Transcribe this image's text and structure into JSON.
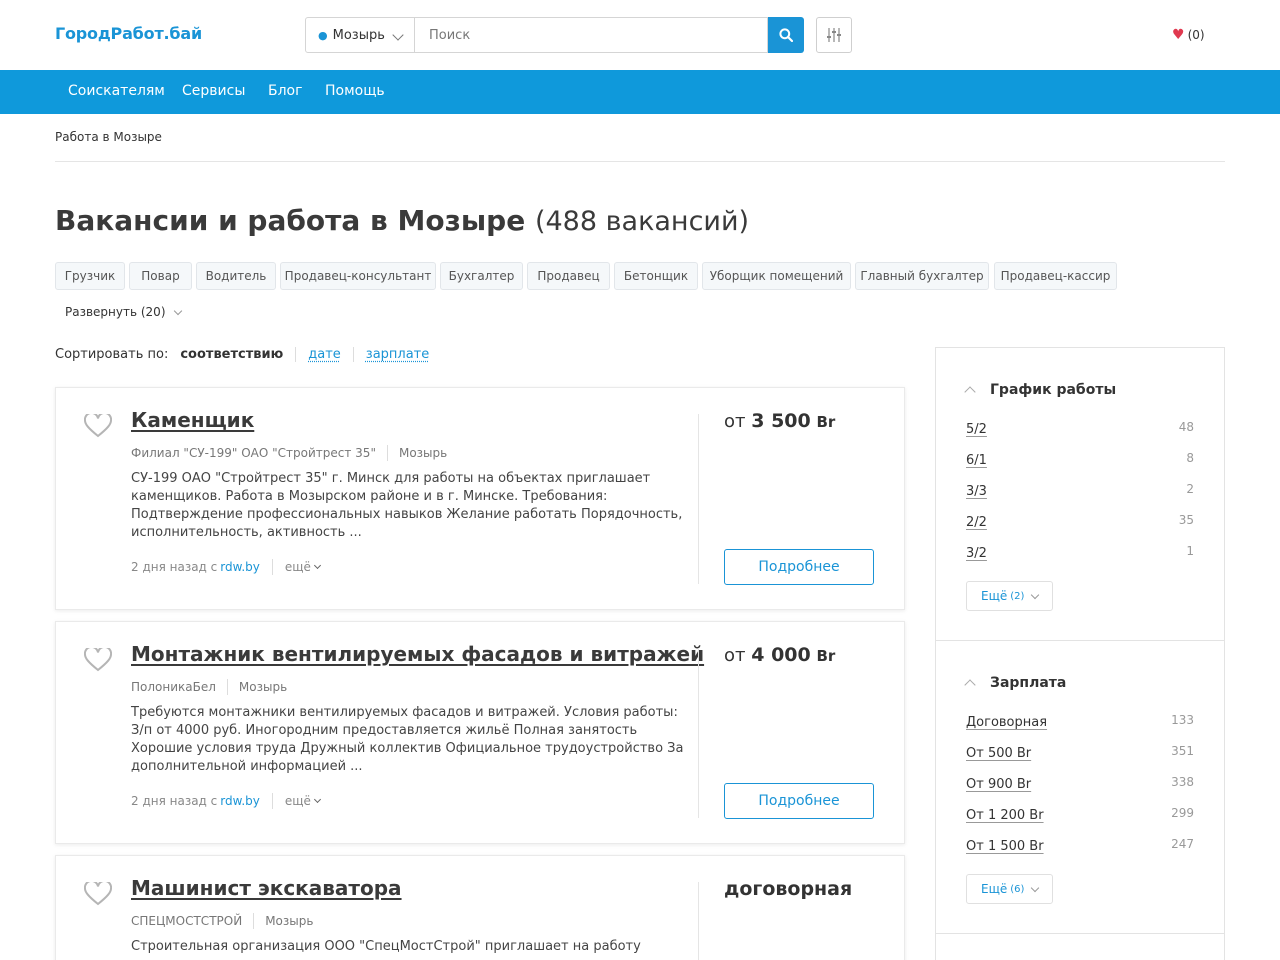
{
  "header": {
    "logo": "ГородРабот.бай",
    "location": "Мозырь",
    "search_placeholder": "Поиск",
    "favorites": "(0)"
  },
  "nav": [
    "Соискателям",
    "Сервисы",
    "Блог",
    "Помощь"
  ],
  "breadcrumb": "Работа в Мозыре",
  "page": {
    "title": "Вакансии и работа в Мозыре",
    "count": "(488 вакансий)"
  },
  "tags": [
    "Грузчик",
    "Повар",
    "Водитель",
    "Продавец-консультант",
    "Бухгалтер",
    "Продавец",
    "Бетонщик",
    "Уборщик помещений",
    "Главный бухгалтер",
    "Продавец-кассир"
  ],
  "expand_label": "Развернуть (20)",
  "sort": {
    "label": "Сортировать по:",
    "active": "соответствию",
    "options": [
      "дате",
      "зарплате"
    ]
  },
  "jobs": [
    {
      "title": "Каменщик",
      "company": "Филиал \"СУ-199\" ОАО \"Стройтрест 35\"",
      "city": "Мозырь",
      "description": "СУ-199 ОАО \"Стройтрест 35\" г. Минск для работы на объектах приглашает каменщиков. Работа в Мозырском районе и в г. Минске. Требования: Подтверждение профессиональных навыков Желание работать Порядочность, исполнительность, активность ...",
      "posted": "2 дня назад с",
      "source": "rdw.by",
      "more": "ещё",
      "salary_prefix": "от",
      "salary_value": "3 500",
      "salary_currency": "Br",
      "button": "Подробнее"
    },
    {
      "title": "Монтажник вентилируемых фасадов и витражей",
      "company": "ПолоникаБел",
      "city": "Мозырь",
      "description": "Требуются монтажники вентилируемых фасадов и витражей. Условия работы: З/п от 4000 руб. Иногородним предоставляется жильё Полная занятость Хорошие условия труда Дружный коллектив Официальное трудоустройство За дополнительной информацией ...",
      "posted": "2 дня назад с",
      "source": "rdw.by",
      "more": "ещё",
      "salary_prefix": "от",
      "salary_value": "4 000",
      "salary_currency": "Br",
      "button": "Подробнее"
    },
    {
      "title": "Машинист экскаватора",
      "company": "СПЕЦМОСТСТРОЙ",
      "city": "Мозырь",
      "description": "Строительная организация ООО \"СпецМостСтрой\" приглашает на работу",
      "salary_text": "договорная"
    }
  ],
  "sidebar": {
    "schedule": {
      "title": "График работы",
      "items": [
        {
          "label": "5/2",
          "count": "48"
        },
        {
          "label": "6/1",
          "count": "8"
        },
        {
          "label": "3/3",
          "count": "2"
        },
        {
          "label": "2/2",
          "count": "35"
        },
        {
          "label": "3/2",
          "count": "1"
        }
      ],
      "more_label": "Ещё",
      "more_count": "(2)"
    },
    "salary": {
      "title": "Зарплата",
      "items": [
        {
          "label": "Договорная",
          "count": "133"
        },
        {
          "label": "От 500 Br",
          "count": "351"
        },
        {
          "label": "От 900 Br",
          "count": "338"
        },
        {
          "label": "От 1 200 Br",
          "count": "299"
        },
        {
          "label": "От 1 500 Br",
          "count": "247"
        }
      ],
      "more_label": "Ещё",
      "more_count": "(6)"
    }
  },
  "colors": {
    "brand": "#1a94d6",
    "nav_bg": "#0f99db",
    "heart": "#e0394f"
  }
}
